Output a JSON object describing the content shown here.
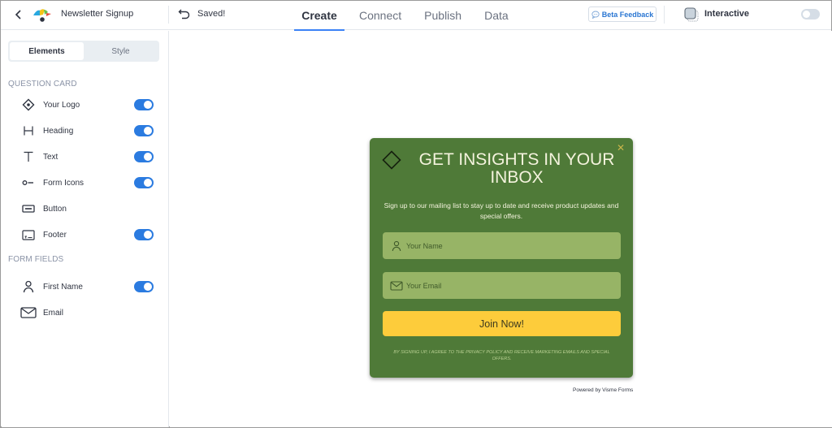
{
  "header": {
    "document_title": "Newsletter Signup",
    "save_status": "Saved!",
    "tabs": [
      {
        "label": "Create",
        "active": true
      },
      {
        "label": "Connect",
        "active": false
      },
      {
        "label": "Publish",
        "active": false
      },
      {
        "label": "Data",
        "active": false
      }
    ],
    "beta_feedback_label": "Beta Feedback",
    "interactive_label": "Interactive",
    "interactive_enabled": false
  },
  "sidebar": {
    "segments": [
      {
        "label": "Elements",
        "active": true
      },
      {
        "label": "Style",
        "active": false
      }
    ],
    "question_card": {
      "title": "QUESTION CARD",
      "items": [
        {
          "label": "Your Logo",
          "icon": "diamond-dot-icon",
          "enabled": true
        },
        {
          "label": "Heading",
          "icon": "heading-icon",
          "enabled": true
        },
        {
          "label": "Text",
          "icon": "text-icon",
          "enabled": true
        },
        {
          "label": "Form Icons",
          "icon": "form-icons-icon",
          "enabled": true
        },
        {
          "label": "Button",
          "icon": "button-icon",
          "enabled": null
        },
        {
          "label": "Footer",
          "icon": "footer-icon",
          "enabled": true
        }
      ]
    },
    "form_fields": {
      "title": "FORM FIELDS",
      "items": [
        {
          "label": "First Name",
          "icon": "user-icon",
          "enabled": true
        },
        {
          "label": "Email",
          "icon": "envelope-icon",
          "enabled": null
        }
      ]
    }
  },
  "form": {
    "heading": "GET INSIGHTS IN YOUR INBOX",
    "subtext": "Sign up to our mailing list to stay up to date and receive product updates and special offers.",
    "name_placeholder": "Your Name",
    "email_placeholder": "Your Email",
    "button_label": "Join Now!",
    "disclaimer": "By signing up,  I agree to the privacy policy and receive marketing emails and special offers.",
    "powered_by": "Powered by Visme Forms",
    "colors": {
      "background": "#4f7a38",
      "field": "#97b466",
      "button": "#fdcc3b",
      "heading_text": "#f4f3dd"
    }
  },
  "colors": {
    "accent": "#2b7be0",
    "tab_underline": "#3b82f6"
  }
}
